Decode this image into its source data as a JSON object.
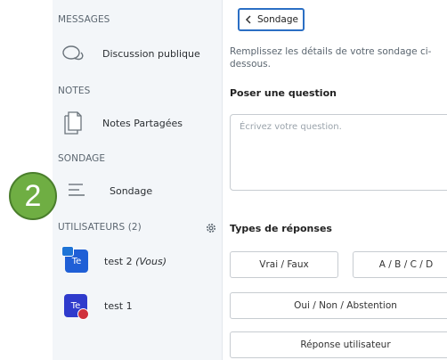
{
  "sidebar": {
    "messages_header": "MESSAGES",
    "public_chat_label": "Discussion publique",
    "notes_header": "NOTES",
    "shared_notes_label": "Notes Partagées",
    "poll_header": "SONDAGE",
    "poll_label": "Sondage",
    "users_header": "UTILISATEURS (2)",
    "users": [
      {
        "avatar": "Te",
        "name": "test 2",
        "suffix": "(Vous)"
      },
      {
        "avatar": "Te",
        "name": "test 1",
        "suffix": ""
      }
    ]
  },
  "callout": {
    "number": "2",
    "color": "#6fae43"
  },
  "main": {
    "back_label": "Sondage",
    "description": "Remplissez les détails de votre sondage ci-dessous.",
    "question_header": "Poser une question",
    "question_placeholder": "Écrivez votre question.",
    "types_header": "Types de réponses",
    "options": [
      "Vrai / Faux",
      "A / B / C / D",
      "Oui / Non / Abstention",
      "Réponse utilisateur"
    ]
  },
  "colors": {
    "accent": "#2b6fc4",
    "sidebar_bg": "#f3f6f9"
  }
}
